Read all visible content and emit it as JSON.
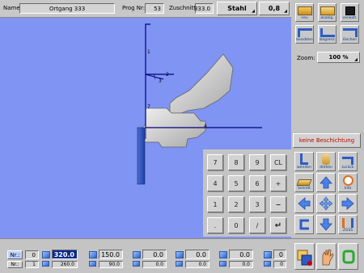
{
  "header": {
    "name_label": "Name:",
    "name_value": "Ortgang  333",
    "prog_label": "Prog Nr:",
    "prog_value": "53",
    "zuschnitt_label": "Zuschnitt:",
    "zuschnitt_value": "333.0",
    "material": "Stahl",
    "thickness": "0,8"
  },
  "tools": {
    "row1": [
      "neu",
      "anzeig.",
      "verwalt."
    ],
    "row2": [
      "bearbten",
      "begrenz",
      "löschen"
    ],
    "zoom_label": "Zoom:",
    "zoom_value": "100 %"
  },
  "drawing": {
    "labels": [
      "1",
      "2",
      "3",
      "7",
      "4"
    ]
  },
  "coating_button": "keine Beschichtung",
  "keypad": {
    "rows": [
      [
        "7",
        "8",
        "9",
        "CL"
      ],
      [
        "4",
        "5",
        "6",
        "+"
      ],
      [
        "1",
        "2",
        "3",
        "−"
      ],
      [
        ".",
        "0",
        "/",
        "↵"
      ]
    ]
  },
  "side_tools": {
    "row1": [
      "wenden",
      "drehen",
      "zurück"
    ],
    "row2": [
      "Schnitt",
      "",
      "Info"
    ],
    "row4": [
      "",
      "",
      "ZGSS"
    ]
  },
  "bottom": {
    "nr_label": "Nr.:",
    "nr_value": "0",
    "nr2_label": "Nr.:",
    "nr2_value": "1",
    "fields_top": [
      "320.0",
      "150.0",
      "0.0",
      "0.0",
      "0.0",
      "0"
    ],
    "fields_bottom": [
      "260.0",
      "90.0",
      "0.0",
      "0.0",
      "0.0",
      "0"
    ]
  },
  "colors": {
    "canvas_bg": "#7f94f3",
    "profile_line": "#00007a",
    "coating_text": "#c00000",
    "highlight_field": "#0a2a8c"
  }
}
